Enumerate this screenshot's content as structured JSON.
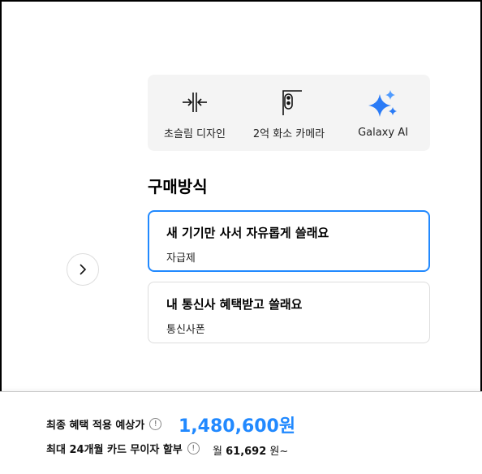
{
  "features": [
    {
      "icon": "slim-design-icon",
      "label": "초슬림 디자인"
    },
    {
      "icon": "camera-icon",
      "label": "2억 화소 카메라"
    },
    {
      "icon": "sparkle-icon",
      "label": "Galaxy AI"
    }
  ],
  "purchase": {
    "title": "구매방식",
    "options": [
      {
        "title": "새 기기만 사서 자유롭게 쓸래요",
        "subtitle": "자급제",
        "selected": true
      },
      {
        "title": "내 통신사 혜택받고 쓸래요",
        "subtitle": "통신사폰",
        "selected": false
      }
    ]
  },
  "footer": {
    "price_label": "최종 혜택 적용 예상가",
    "price_value": "1,480,600원",
    "installment_label": "최대 24개월 카드 무이자 할부",
    "installment_prefix": "월",
    "installment_value": "61,692",
    "installment_suffix": "원~",
    "info_symbol": "!"
  },
  "colors": {
    "accent": "#2189ff",
    "sparkle": "#2a7bf6"
  }
}
